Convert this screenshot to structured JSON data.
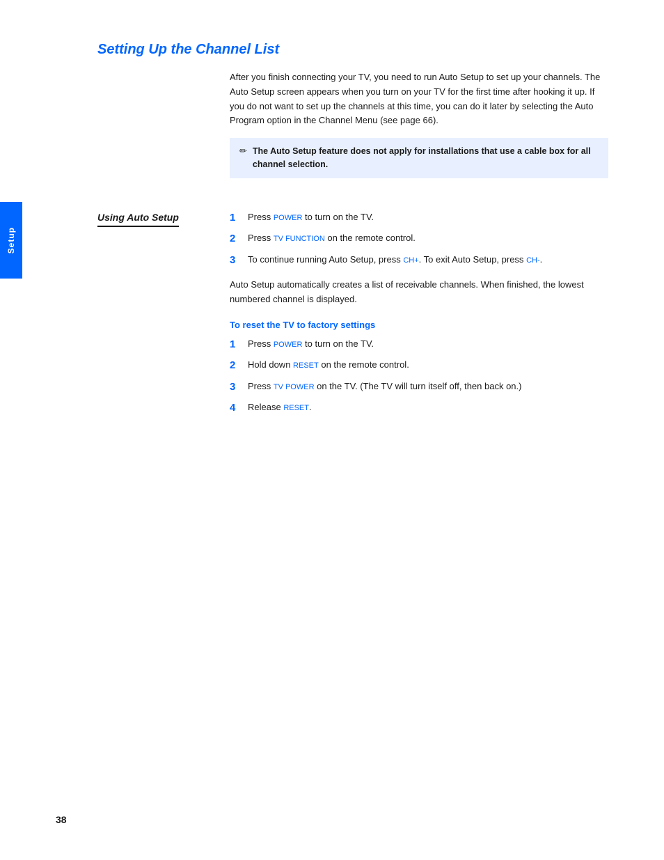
{
  "page": {
    "number": "38",
    "sidebar_label": "Setup"
  },
  "title": "Setting Up the Channel List",
  "intro": {
    "paragraph": "After you finish connecting your TV, you need to run Auto Setup to set up your channels. The Auto Setup screen appears when you turn on your TV for the first time after hooking it up. If you do not want to set up the channels at this time, you can do it later by selecting the Auto Program option in the Channel Menu (see page 66)."
  },
  "note": {
    "icon": "✏",
    "text": "The Auto Setup feature does not apply for installations that use a cable box for all channel selection."
  },
  "using_auto_setup": {
    "subtitle": "Using Auto Setup",
    "steps": [
      {
        "number": "1",
        "parts": [
          {
            "text": "Press ",
            "plain": true
          },
          {
            "text": "POWER",
            "keyword": true
          },
          {
            "text": " to turn on the TV.",
            "plain": true
          }
        ],
        "full_text": "Press POWER to turn on the TV."
      },
      {
        "number": "2",
        "parts": [
          {
            "text": "Press ",
            "plain": true
          },
          {
            "text": "TV FUNCTION",
            "keyword": true
          },
          {
            "text": " on the remote control.",
            "plain": true
          }
        ],
        "full_text": "Press TV FUNCTION on the remote control."
      },
      {
        "number": "3",
        "parts": [
          {
            "text": "To continue running Auto Setup, press ",
            "plain": true
          },
          {
            "text": "CH+",
            "keyword": true
          },
          {
            "text": ". To exit Auto Setup, press ",
            "plain": true
          },
          {
            "text": "CH-",
            "keyword": true
          },
          {
            "text": ".",
            "plain": true
          }
        ],
        "full_text": "To continue running Auto Setup, press CH+. To exit Auto Setup, press CH-."
      }
    ],
    "after_steps_text": "Auto Setup automatically creates a list of receivable channels. When finished, the lowest numbered channel is displayed."
  },
  "reset_section": {
    "title": "To reset the TV to factory settings",
    "steps": [
      {
        "number": "1",
        "text": "Press POWER to turn on the TV.",
        "keyword": "POWER",
        "before_kw": "Press ",
        "after_kw": " to turn on the TV."
      },
      {
        "number": "2",
        "text": "Hold down RESET on the remote control.",
        "keyword": "RESET",
        "before_kw": "Hold down ",
        "after_kw": " on the remote control."
      },
      {
        "number": "3",
        "text": "Press TV POWER on the TV. (The TV will turn itself off, then back on.)",
        "keyword": "TV POWER",
        "before_kw": "Press ",
        "after_kw": " on the TV. (The TV will turn itself off, then back on.)"
      },
      {
        "number": "4",
        "text": "Release RESET.",
        "keyword": "RESET",
        "before_kw": "Release ",
        "after_kw": "."
      }
    ]
  }
}
